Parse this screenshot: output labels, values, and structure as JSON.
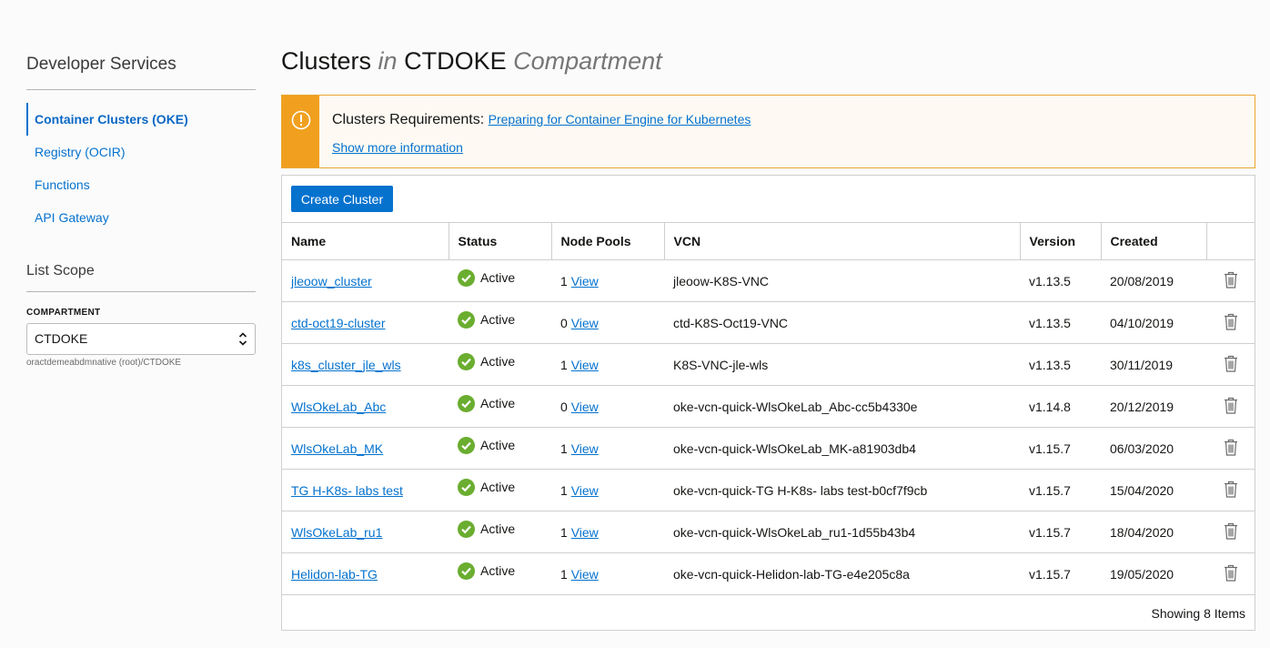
{
  "sidebar": {
    "title": "Developer Services",
    "nav": [
      {
        "label": "Container Clusters (OKE)",
        "active": true
      },
      {
        "label": "Registry (OCIR)",
        "active": false
      },
      {
        "label": "Functions",
        "active": false
      },
      {
        "label": "API Gateway",
        "active": false
      }
    ],
    "list_scope_title": "List Scope",
    "compartment_label": "COMPARTMENT",
    "compartment_value": "CTDOKE",
    "compartment_path": "oractdemeabdmnative (root)/CTDOKE"
  },
  "page": {
    "title_main": "Clusters",
    "title_in": "in",
    "title_compartment": "CTDOKE",
    "title_suffix": "Compartment"
  },
  "notice": {
    "label": "Clusters Requirements:",
    "link": "Preparing for Container Engine for Kubernetes",
    "more": "Show more information",
    "icon": "warning-icon",
    "color": "#f0a01e"
  },
  "toolbar": {
    "create_label": "Create Cluster"
  },
  "table": {
    "headers": [
      "Name",
      "Status",
      "Node Pools",
      "VCN",
      "Version",
      "Created"
    ],
    "view_label": "View",
    "rows": [
      {
        "name": "jleoow_cluster",
        "status": "Active",
        "pools": "1",
        "vcn": "jleoow-K8S-VNC",
        "version": "v1.13.5",
        "created": "20/08/2019"
      },
      {
        "name": "ctd-oct19-cluster",
        "status": "Active",
        "pools": "0",
        "vcn": "ctd-K8S-Oct19-VNC",
        "version": "v1.13.5",
        "created": "04/10/2019"
      },
      {
        "name": "k8s_cluster_jle_wls",
        "status": "Active",
        "pools": "1",
        "vcn": "K8S-VNC-jle-wls",
        "version": "v1.13.5",
        "created": "30/11/2019"
      },
      {
        "name": "WlsOkeLab_Abc",
        "status": "Active",
        "pools": "0",
        "vcn": "oke-vcn-quick-WlsOkeLab_Abc-cc5b4330e",
        "version": "v1.14.8",
        "created": "20/12/2019"
      },
      {
        "name": "WlsOkeLab_MK",
        "status": "Active",
        "pools": "1",
        "vcn": "oke-vcn-quick-WlsOkeLab_MK-a81903db4",
        "version": "v1.15.7",
        "created": "06/03/2020"
      },
      {
        "name": "TG H-K8s- labs test",
        "status": "Active",
        "pools": "1",
        "vcn": "oke-vcn-quick-TG H-K8s- labs test-b0cf7f9cb",
        "version": "v1.15.7",
        "created": "15/04/2020"
      },
      {
        "name": "WlsOkeLab_ru1",
        "status": "Active",
        "pools": "1",
        "vcn": "oke-vcn-quick-WlsOkeLab_ru1-1d55b43b4",
        "version": "v1.15.7",
        "created": "18/04/2020"
      },
      {
        "name": "Helidon-lab-TG",
        "status": "Active",
        "pools": "1",
        "vcn": "oke-vcn-quick-Helidon-lab-TG-e4e205c8a",
        "version": "v1.15.7",
        "created": "19/05/2020"
      }
    ],
    "footer": "Showing 8 Items",
    "status_color": "#6aad2f",
    "row_icons": [
      "check-circle-icon",
      "trash-icon"
    ]
  },
  "colors": {
    "accent": "#0572ce",
    "warning": "#f0a01e",
    "success": "#6aad2f"
  }
}
